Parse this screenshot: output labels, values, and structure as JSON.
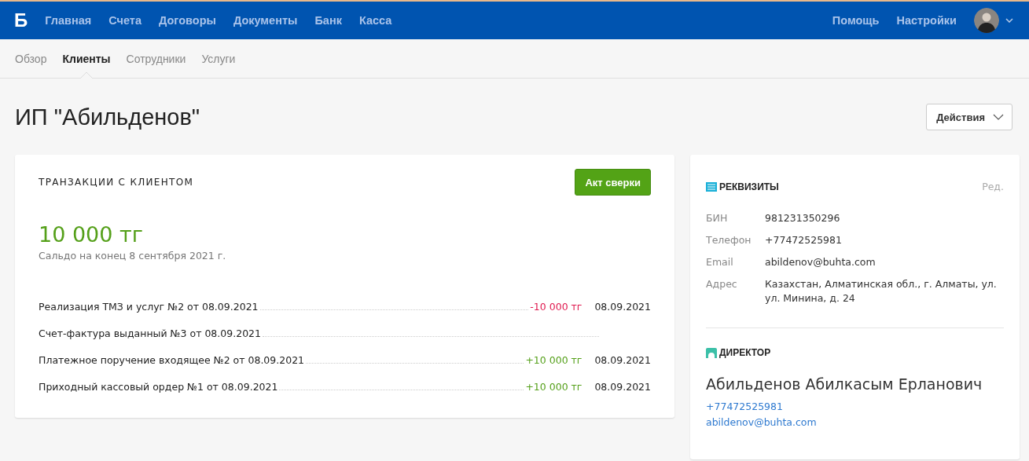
{
  "topbar": {
    "logo": "Б",
    "nav": [
      {
        "label": "Главная"
      },
      {
        "label": "Счета"
      },
      {
        "label": "Договоры"
      },
      {
        "label": "Документы"
      },
      {
        "label": "Банк"
      },
      {
        "label": "Касса"
      }
    ],
    "right_links": [
      {
        "label": "Помощь"
      },
      {
        "label": "Настройки"
      }
    ]
  },
  "subnav": [
    {
      "label": "Обзор",
      "selected": false
    },
    {
      "label": "Клиенты",
      "selected": true
    },
    {
      "label": "Сотрудники",
      "selected": false
    },
    {
      "label": "Услуги",
      "selected": false
    }
  ],
  "page_title": "ИП \"Абильденов\"",
  "actions_button": "Действия",
  "transactions": {
    "title": "ТРАНЗАКЦИИ С КЛИЕНТОМ",
    "button": "Акт сверки",
    "balance": "10 000 тг",
    "balance_caption": "Сальдо на конец 8 сентября 2021 г.",
    "rows": [
      {
        "name": "Реализация ТМЗ и услуг №2 от 08.09.2021",
        "kind": "outgoing",
        "amount": "-10 000 тг",
        "date": "08.09.2021"
      },
      {
        "name": "Счет-фактура выданный №3 от 08.09.2021",
        "kind": "document"
      },
      {
        "name": "Платежное поручение входящее №2 от 08.09.2021",
        "kind": "incoming",
        "amount": "+10 000 тг",
        "date": "08.09.2021"
      },
      {
        "name": "Приходный кассовый ордер №1 от 08.09.2021",
        "kind": "incoming",
        "amount": "+10 000 тг",
        "date": "08.09.2021"
      }
    ]
  },
  "details": {
    "title": "РЕКВИЗИТЫ",
    "edit": "Ред.",
    "fields": [
      {
        "label": "БИН",
        "value": "981231350296"
      },
      {
        "label": "Телефон",
        "value": "+77472525981"
      },
      {
        "label": "Email",
        "value": "abildenov@buhta.com"
      },
      {
        "label": "Адрес",
        "value": "Казахстан, Алматинская обл., г. Алматы, ул. ул. Минина, д. 24"
      }
    ]
  },
  "director": {
    "title": "ДИРЕКТОР",
    "name": "Абильденов Абилкасым Ерланович",
    "phone": "+77472525981",
    "email": "abildenov@buhta.com"
  }
}
